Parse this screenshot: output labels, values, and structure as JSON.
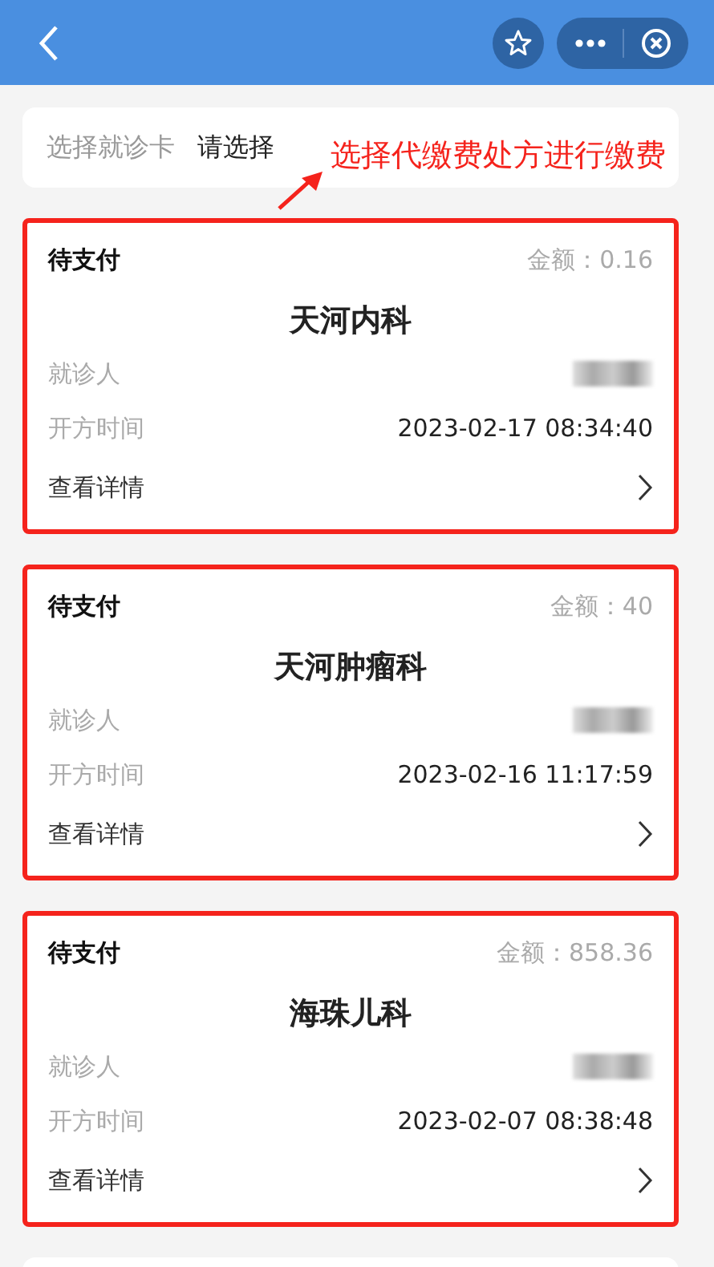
{
  "card_selector": {
    "label": "选择就诊卡",
    "value": "请选择"
  },
  "annotation": {
    "text": "选择代缴费处方进行缴费"
  },
  "prescriptions": [
    {
      "status": "待支付",
      "amount": "金额：0.16",
      "department": "天河内科",
      "patient_label": "就诊人",
      "time_label": "开方时间",
      "time": "2023-02-17 08:34:40",
      "details_label": "查看详情",
      "highlighted": true
    },
    {
      "status": "待支付",
      "amount": "金额：40",
      "department": "天河肿瘤科",
      "patient_label": "就诊人",
      "time_label": "开方时间",
      "time": "2023-02-16 11:17:59",
      "details_label": "查看详情",
      "highlighted": true
    },
    {
      "status": "待支付",
      "amount": "金额：858.36",
      "department": "海珠儿科",
      "patient_label": "就诊人",
      "time_label": "开方时间",
      "time": "2023-02-07 08:38:48",
      "details_label": "查看详情",
      "highlighted": true
    }
  ]
}
